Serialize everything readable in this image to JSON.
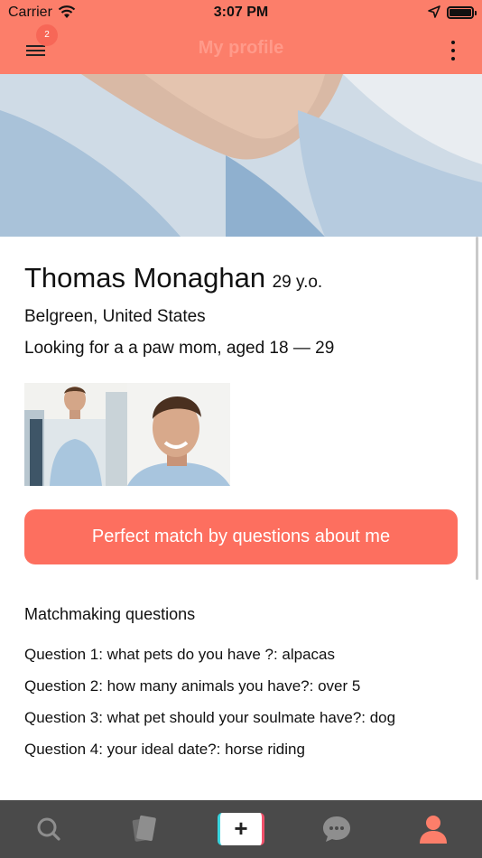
{
  "status_bar": {
    "carrier": "Carrier",
    "time": "3:07 PM"
  },
  "nav": {
    "title": "My profile",
    "badge_count": "2",
    "menu_icon": "hamburger-icon",
    "more_icon": "more-vertical-icon"
  },
  "profile": {
    "name": "Thomas Monaghan",
    "age": "29 y.o.",
    "location": "Belgreen, United States",
    "looking_for": "Looking for a a paw mom, aged 18 — 29"
  },
  "match_button_label": "Perfect match by questions about me",
  "questions": {
    "heading": "Matchmaking questions",
    "items": [
      "Question 1: what pets do you have ?: alpacas",
      "Question 2: how many animals you have?: over 5",
      "Question 3: what pet should your soulmate have?: dog",
      "Question 4: your ideal date?: horse riding"
    ]
  },
  "tab_bar": {
    "items": [
      "search-icon",
      "cards-icon",
      "add-button",
      "chat-icon",
      "profile-icon"
    ],
    "plus_label": "+",
    "active_color": "#fc7e6a",
    "inactive_color": "#8e8e8e"
  },
  "colors": {
    "accent": "#fc7e6a",
    "button": "#fd6f5f",
    "tab_bar": "#4a4a4a"
  }
}
